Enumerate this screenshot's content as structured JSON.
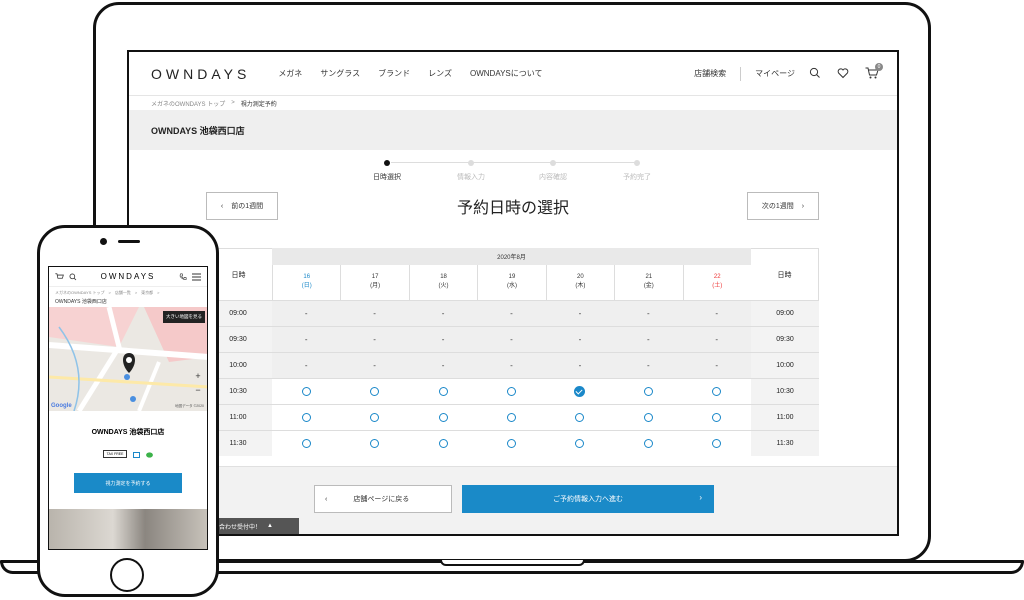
{
  "desktop": {
    "logo": "OWNDAYS",
    "nav": [
      "メガネ",
      "サングラス",
      "ブランド",
      "レンズ",
      "OWNDAYSについて"
    ],
    "header_links": {
      "store_search": "店舗検索",
      "mypage": "マイページ"
    },
    "cart_count": "0",
    "breadcrumb": {
      "home": "メガネのOWNDAYS トップ",
      "sep": ">",
      "current": "視力測定予約"
    },
    "store_name": "OWNDAYS 池袋西口店",
    "steps": [
      "日時選択",
      "情報入力",
      "内容確認",
      "予約完了"
    ],
    "prev_week": "前の1週間",
    "next_week": "次の1週間",
    "page_title": "予約日時の選択",
    "table": {
      "side_header": "日時",
      "month": "2020年8月",
      "days": [
        {
          "num": "16",
          "dow": "(日)",
          "type": "sun"
        },
        {
          "num": "17",
          "dow": "(月)",
          "type": ""
        },
        {
          "num": "18",
          "dow": "(火)",
          "type": ""
        },
        {
          "num": "19",
          "dow": "(水)",
          "type": ""
        },
        {
          "num": "20",
          "dow": "(木)",
          "type": ""
        },
        {
          "num": "21",
          "dow": "(金)",
          "type": ""
        },
        {
          "num": "22",
          "dow": "(土)",
          "type": "sat"
        }
      ],
      "rows": [
        {
          "time": "09:00",
          "slots": [
            "-",
            "-",
            "-",
            "-",
            "-",
            "-",
            "-"
          ]
        },
        {
          "time": "09:30",
          "slots": [
            "-",
            "-",
            "-",
            "-",
            "-",
            "-",
            "-"
          ]
        },
        {
          "time": "10:00",
          "slots": [
            "-",
            "-",
            "-",
            "-",
            "-",
            "-",
            "-"
          ]
        },
        {
          "time": "10:30",
          "slots": [
            "o",
            "o",
            "o",
            "o",
            "check",
            "o",
            "o"
          ]
        },
        {
          "time": "11:00",
          "slots": [
            "o",
            "o",
            "o",
            "o",
            "o",
            "o",
            "o"
          ]
        },
        {
          "time": "11:30",
          "slots": [
            "o",
            "o",
            "o",
            "o",
            "o",
            "o",
            "o"
          ]
        }
      ]
    },
    "back_button": "店舗ページに戻る",
    "next_button": "ご予約情報入力へ進む",
    "inquiry_tab": "合わせ受付中！"
  },
  "mobile": {
    "logo": "OWNDAYS",
    "breadcrumb": "メガネのOWNDAYS トップ　>　店舗一覧　>　東京都　>",
    "store_small": "OWNDAYS 池袋西口店",
    "map_button": "大きい地図を見る",
    "google": "Google",
    "map_copy": "地図データ ©2020",
    "store_name": "OWNDAYS 池袋西口店",
    "tax_free": "TAX FREE",
    "reserve_button": "視力測定を予約する"
  },
  "colors": {
    "accent": "#1a8ac8",
    "saturday": "#e33333",
    "sunday": "#1a88c9"
  }
}
